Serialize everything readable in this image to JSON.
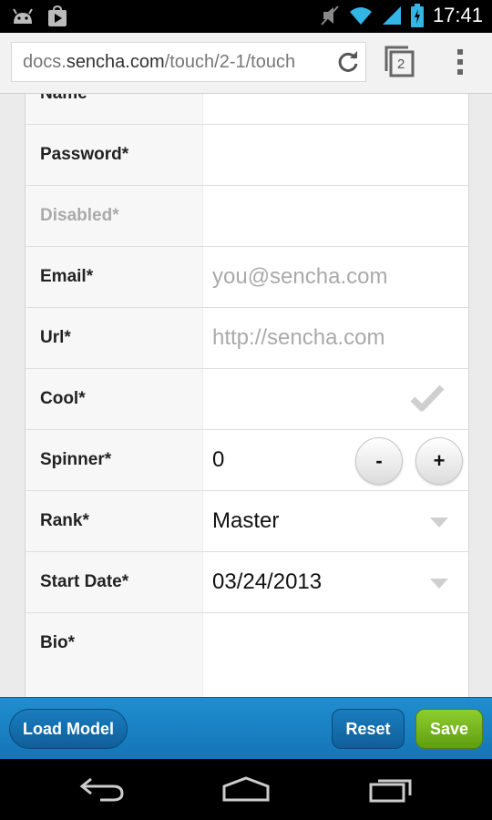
{
  "status_bar": {
    "time": "17:41",
    "icons": [
      "android-icon",
      "play-store-icon",
      "muted-icon",
      "wifi-icon",
      "signal-icon",
      "battery-icon"
    ]
  },
  "browser": {
    "url_domain_prefix": "docs.",
    "url_domain": "sencha.com",
    "url_path": "/touch/2-1/touch",
    "tab_count": "2",
    "icons": [
      "reload-icon",
      "tabs-icon",
      "overflow-menu-icon"
    ]
  },
  "form": {
    "fields": [
      {
        "label": "Name*",
        "value": ""
      },
      {
        "label": "Password*",
        "value": ""
      },
      {
        "label": "Disabled*",
        "value": ""
      },
      {
        "label": "Email*",
        "placeholder": "you@sencha.com"
      },
      {
        "label": "Url*",
        "placeholder": "http://sencha.com"
      },
      {
        "label": "Cool*",
        "checked": false
      },
      {
        "label": "Spinner*",
        "value": "0",
        "decrement": "-",
        "increment": "+"
      },
      {
        "label": "Rank*",
        "value": "Master"
      },
      {
        "label": "Start Date*",
        "value": "03/24/2013"
      },
      {
        "label": "Bio*",
        "value": ""
      }
    ]
  },
  "toolbar": {
    "load_model": "Load Model",
    "reset": "Reset",
    "save": "Save"
  },
  "colors": {
    "toolbar_blue": "#1680c4",
    "save_green": "#77b520"
  },
  "nav_bar": {
    "icons": [
      "back-icon",
      "home-icon",
      "recent-apps-icon"
    ]
  }
}
